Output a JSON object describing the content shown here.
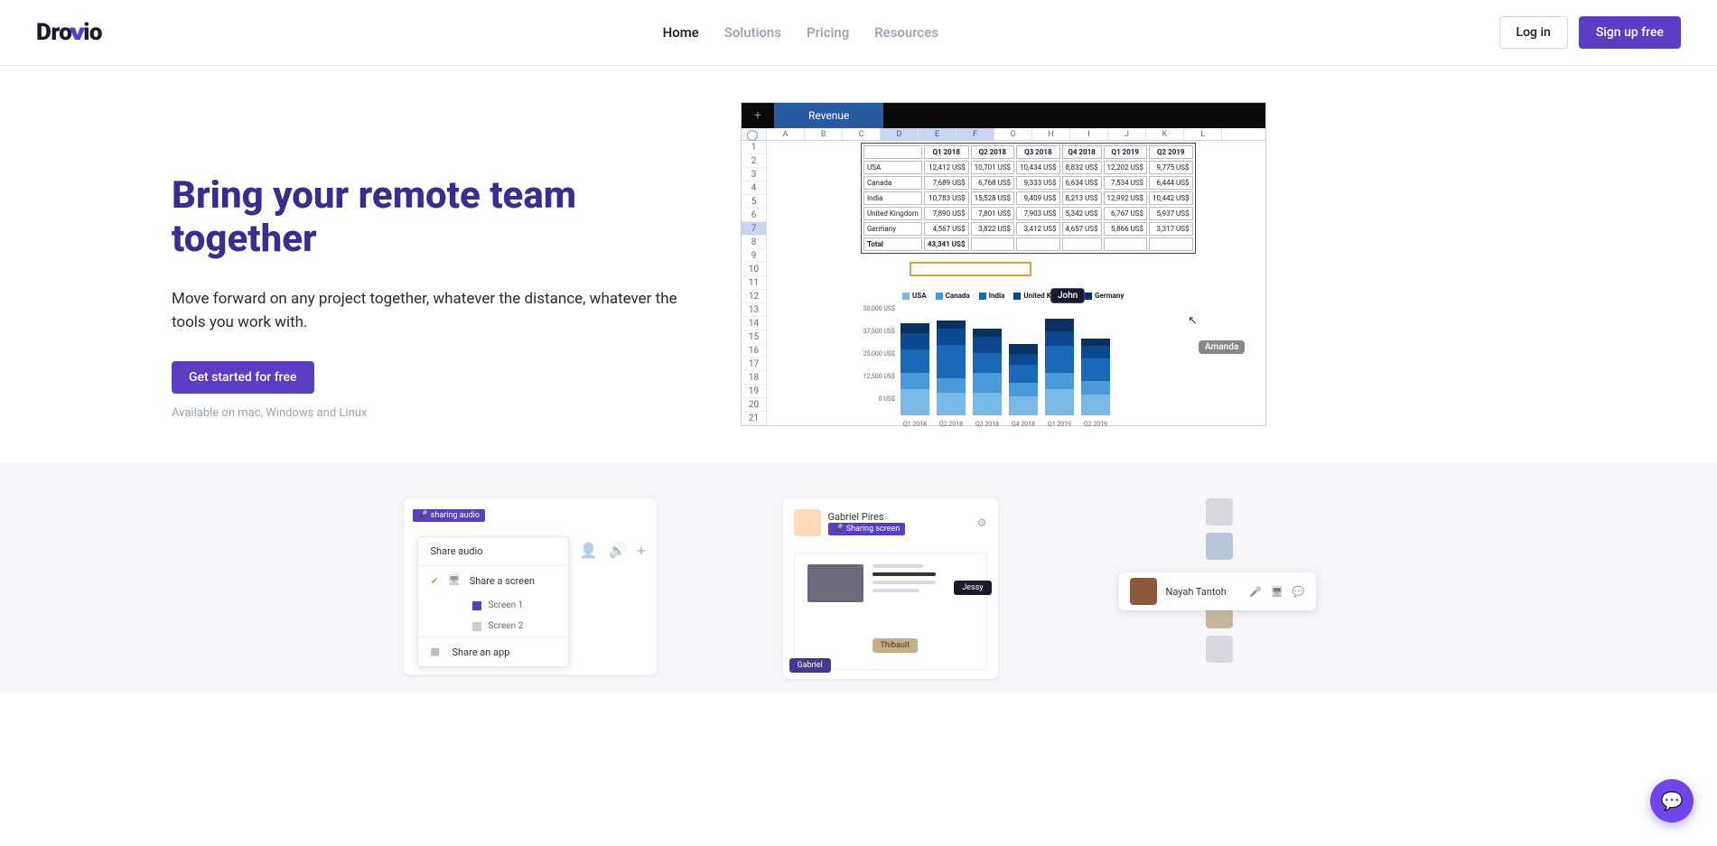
{
  "brand": {
    "pre": "Dro",
    "post": "io"
  },
  "nav": {
    "home": "Home",
    "solutions": "Solutions",
    "pricing": "Pricing",
    "resources": "Resources"
  },
  "auth": {
    "login": "Log in",
    "signup": "Sign up free"
  },
  "hero": {
    "title": "Bring your remote team together",
    "subtitle": "Move forward on any project together, whatever the distance, whatever the tools you work with.",
    "cta": "Get started for free",
    "note": "Available on mac, Windows and Linux"
  },
  "sheet": {
    "tab": "Revenue",
    "columns": [
      "A",
      "B",
      "C",
      "D",
      "E",
      "F",
      "G",
      "H",
      "I",
      "J",
      "K",
      "L"
    ],
    "rows": [
      "1",
      "2",
      "3",
      "4",
      "5",
      "6",
      "7",
      "8",
      "9",
      "10",
      "11",
      "12",
      "13",
      "14",
      "15",
      "16",
      "17",
      "18",
      "19",
      "20",
      "21"
    ],
    "headers": [
      "",
      "Q1 2018",
      "Q2 2018",
      "Q3 2018",
      "Q4 2018",
      "Q1 2019",
      "Q2 2019"
    ],
    "data": [
      [
        "USA",
        "12,412 US$",
        "10,701 US$",
        "10,434 US$",
        "8,832 US$",
        "12,202 US$",
        "9,775 US$"
      ],
      [
        "Canada",
        "7,689 US$",
        "6,768 US$",
        "9,333 US$",
        "6,634 US$",
        "7,534 US$",
        "6,444 US$"
      ],
      [
        "India",
        "10,783 US$",
        "15,528 US$",
        "9,409 US$",
        "8,213 US$",
        "12,992 US$",
        "10,442 US$"
      ],
      [
        "United Kingdom",
        "7,890 US$",
        "7,801 US$",
        "7,903 US$",
        "5,342 US$",
        "6,767 US$",
        "5,937 US$"
      ],
      [
        "Germany",
        "4,567 US$",
        "3,822 US$",
        "3,412 US$",
        "4,657 US$",
        "5,866 US$",
        "3,317 US$"
      ],
      [
        "Total",
        "43,341 US$",
        "",
        "",
        "",
        "",
        ""
      ]
    ],
    "legend": [
      "USA",
      "Canada",
      "India",
      "United Kingdom",
      "Germany"
    ],
    "legend_colors": [
      "#7ab8e8",
      "#4a98d8",
      "#1a68b8",
      "#0a4890",
      "#083060"
    ],
    "ylabels": [
      "50,000 US$",
      "37,500 US$",
      "25,000 US$",
      "12,500 US$",
      "0 US$"
    ],
    "xlabels": [
      "Q1 2018",
      "Q2 2018",
      "Q3 2018",
      "Q4 2018",
      "Q1 2019",
      "Q2 2019"
    ],
    "cursors": {
      "john": "John",
      "amanda": "Amanda"
    }
  },
  "chart_data": {
    "type": "bar",
    "title": "Revenue",
    "xlabel": "",
    "ylabel": "",
    "ylim": [
      0,
      50000
    ],
    "categories": [
      "Q1 2018",
      "Q2 2018",
      "Q3 2018",
      "Q4 2018",
      "Q1 2019",
      "Q2 2019"
    ],
    "series": [
      {
        "name": "USA",
        "color": "#7ab8e8",
        "values": [
          12412,
          10701,
          10434,
          8832,
          12202,
          9775
        ]
      },
      {
        "name": "Canada",
        "color": "#4a98d8",
        "values": [
          7689,
          6768,
          9333,
          6634,
          7534,
          6444
        ]
      },
      {
        "name": "India",
        "color": "#1a68b8",
        "values": [
          10783,
          15528,
          9409,
          8213,
          12992,
          10442
        ]
      },
      {
        "name": "United Kingdom",
        "color": "#0a4890",
        "values": [
          7890,
          7801,
          7903,
          5342,
          6767,
          5937
        ]
      },
      {
        "name": "Germany",
        "color": "#083060",
        "values": [
          4567,
          3822,
          3412,
          4657,
          5866,
          3317
        ]
      }
    ]
  },
  "card1": {
    "badge": "sharing audio",
    "share_audio": "Share audio",
    "share_screen": "Share a screen",
    "screen1": "Screen 1",
    "screen2": "Screen 2",
    "share_app": "Share an app"
  },
  "card2": {
    "user": "Gabriel Pires",
    "badge": "Sharing screen",
    "tags": {
      "gabriel": "Gabriel",
      "thibault": "Thibault",
      "jessy": "Jessy"
    }
  },
  "card3": {
    "name": "Nayah Tantoh"
  }
}
